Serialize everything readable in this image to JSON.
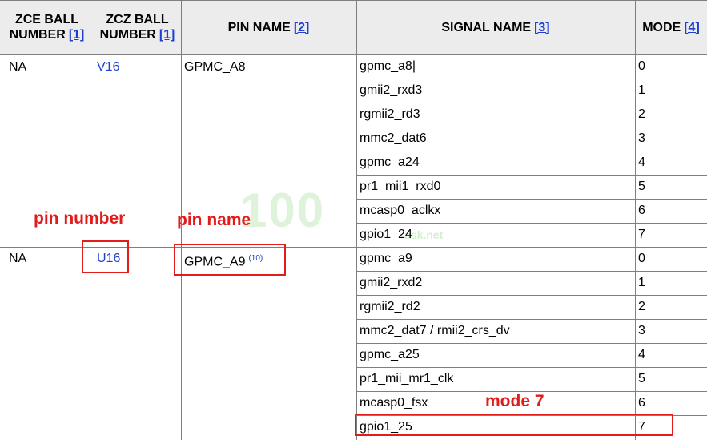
{
  "headers": {
    "zce": {
      "line1": "ZCE BALL",
      "line2": "NUMBER",
      "ref": "[1]"
    },
    "zcz": {
      "line1": "ZCZ BALL",
      "line2": "NUMBER",
      "ref": "[1]"
    },
    "pin": {
      "label": "PIN NAME",
      "ref": "[2]"
    },
    "signal": {
      "label": "SIGNAL NAME",
      "ref": "[3]"
    },
    "mode": {
      "label": "MODE",
      "ref": "[4]"
    }
  },
  "groups": [
    {
      "zce": "NA",
      "zcz": "V16",
      "pin": "GPMC_A8",
      "pin_note": "",
      "signals": [
        {
          "name": "gpmc_a8|",
          "mode": "0"
        },
        {
          "name": "gmii2_rxd3",
          "mode": "1"
        },
        {
          "name": "rgmii2_rd3",
          "mode": "2"
        },
        {
          "name": "mmc2_dat6",
          "mode": "3"
        },
        {
          "name": "gpmc_a24",
          "mode": "4"
        },
        {
          "name": "pr1_mii1_rxd0",
          "mode": "5"
        },
        {
          "name": "mcasp0_aclkx",
          "mode": "6"
        },
        {
          "name": "gpio1_24",
          "mode": "7"
        }
      ]
    },
    {
      "zce": "NA",
      "zcz": "U16",
      "pin": "GPMC_A9",
      "pin_note": "(10)",
      "signals": [
        {
          "name": "gpmc_a9",
          "mode": "0"
        },
        {
          "name": "gmii2_rxd2",
          "mode": "1"
        },
        {
          "name": "rgmii2_rd2",
          "mode": "2"
        },
        {
          "name": "mmc2_dat7 / rmii2_crs_dv",
          "mode": "3"
        },
        {
          "name": "gpmc_a25",
          "mode": "4"
        },
        {
          "name": "pr1_mii_mr1_clk",
          "mode": "5"
        },
        {
          "name": "mcasp0_fsx",
          "mode": "6"
        },
        {
          "name": "gpio1_25",
          "mode": "7"
        }
      ]
    }
  ],
  "annotations": {
    "pin_number": "pin number",
    "pin_name": "pin name",
    "mode7": "mode 7"
  },
  "watermark": {
    "main": "100",
    "sub": "ask.net"
  },
  "colors": {
    "link": "#1f3fd1",
    "annotation": "#e21b1b",
    "header_bg": "#ececec",
    "grid": "#7f7f7f"
  }
}
